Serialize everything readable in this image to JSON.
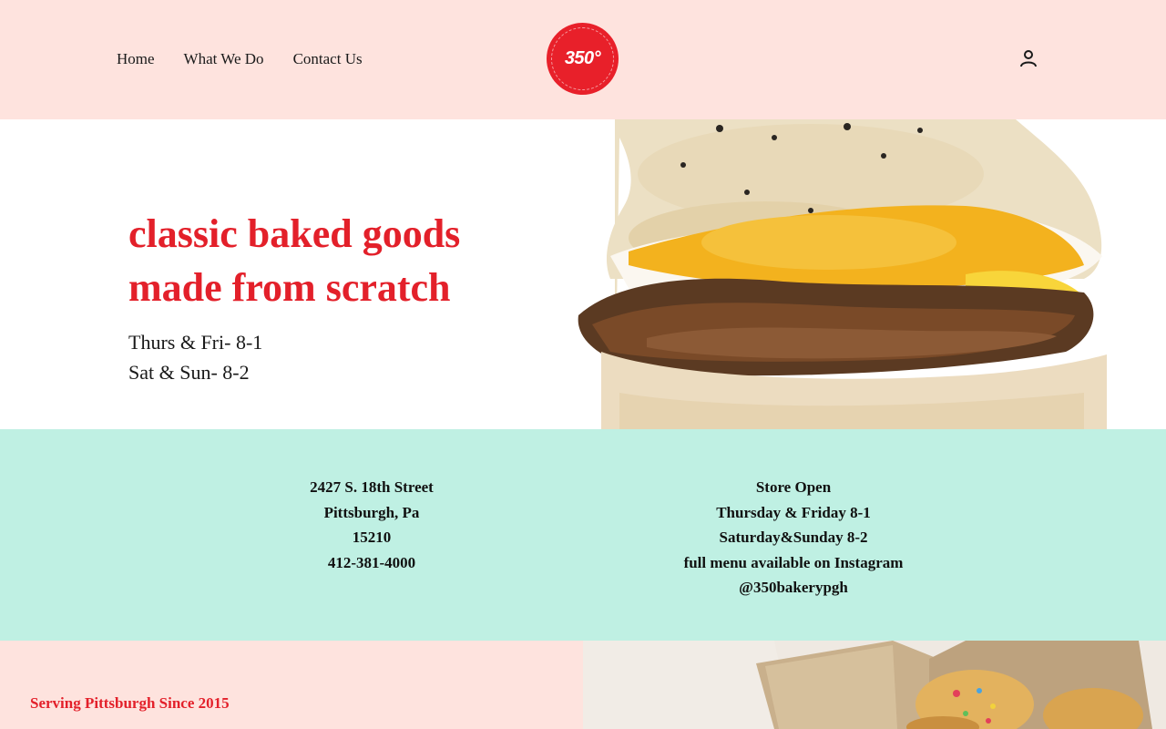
{
  "nav": {
    "items": [
      "Home",
      "What We Do",
      "Contact Us"
    ]
  },
  "logo": {
    "text": "350°"
  },
  "account": {
    "icon": "user-icon"
  },
  "hero": {
    "headline_line1": "classic baked goods",
    "headline_line2": "made from scratch",
    "hours_line1": "Thurs & Fri- 8-1",
    "hours_line2": "Sat & Sun- 8-2"
  },
  "address": {
    "street": "2427 S. 18th Street",
    "city": "Pittsburgh, Pa",
    "zip": "15210",
    "phone": "412-381-4000"
  },
  "store": {
    "title": "Store Open",
    "line1": "Thursday & Friday 8-1",
    "line2": "Saturday&Sunday 8-2",
    "line3": "full menu available on Instagram",
    "line4": "@350bakerypgh"
  },
  "footer": {
    "since": "Serving Pittsburgh Since 2015"
  },
  "colors": {
    "accent": "#e3202a",
    "header_bg": "#fee3de",
    "info_bg": "#bff0e3"
  }
}
